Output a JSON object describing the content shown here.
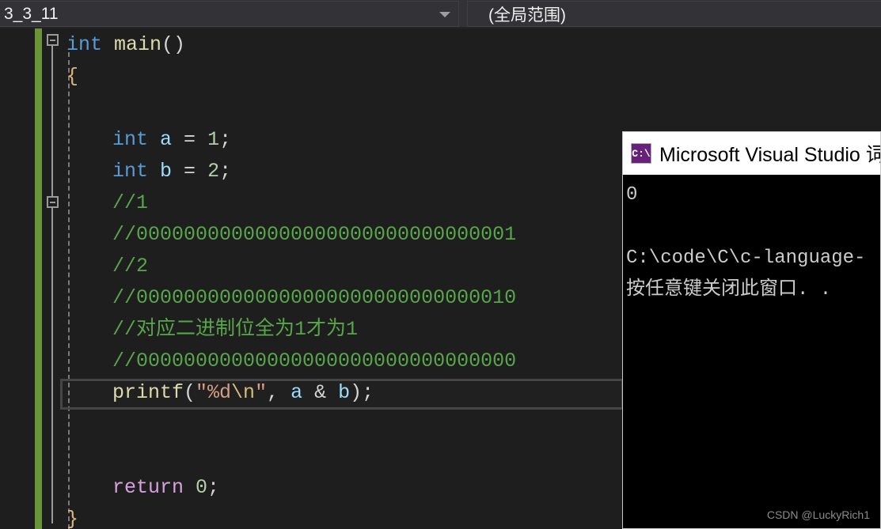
{
  "topbar": {
    "scope_combo": {
      "value": "3_3_11",
      "arrow_icon": "chevron-down-icon"
    },
    "member_combo": {
      "value": "(全局范围)"
    }
  },
  "editor": {
    "change_bar_color": "#6a9437",
    "theme_bg": "#1e1e1e",
    "fold_markers": [
      {
        "name": "fold-marker-main",
        "state": "expanded"
      },
      {
        "name": "fold-marker-block",
        "state": "expanded"
      }
    ],
    "lines": [
      {
        "id": "line-1",
        "indent": 0,
        "segments": [
          {
            "t": "int",
            "c": "kw"
          },
          {
            "t": " ",
            "c": "punc"
          },
          {
            "t": "main",
            "c": "fn"
          },
          {
            "t": "()",
            "c": "punc"
          }
        ]
      },
      {
        "id": "line-2",
        "indent": 0,
        "segments": [
          {
            "t": "{",
            "c": "brace"
          }
        ]
      },
      {
        "id": "line-3",
        "indent": 0,
        "segments": [
          {
            "t": "",
            "c": "punc"
          }
        ]
      },
      {
        "id": "line-4",
        "indent": 1,
        "segments": [
          {
            "t": "int",
            "c": "kw"
          },
          {
            "t": " ",
            "c": "punc"
          },
          {
            "t": "a",
            "c": "var"
          },
          {
            "t": " = ",
            "c": "punc"
          },
          {
            "t": "1",
            "c": "num"
          },
          {
            "t": ";",
            "c": "punc"
          }
        ]
      },
      {
        "id": "line-5",
        "indent": 1,
        "segments": [
          {
            "t": "int",
            "c": "kw"
          },
          {
            "t": " ",
            "c": "punc"
          },
          {
            "t": "b",
            "c": "var"
          },
          {
            "t": " = ",
            "c": "punc"
          },
          {
            "t": "2",
            "c": "num"
          },
          {
            "t": ";",
            "c": "punc"
          }
        ]
      },
      {
        "id": "line-6",
        "indent": 1,
        "segments": [
          {
            "t": "//1",
            "c": "comment"
          }
        ]
      },
      {
        "id": "line-7",
        "indent": 1,
        "segments": [
          {
            "t": "//00000000000000000000000000000001",
            "c": "comment"
          }
        ]
      },
      {
        "id": "line-8",
        "indent": 1,
        "segments": [
          {
            "t": "//2",
            "c": "comment"
          }
        ]
      },
      {
        "id": "line-9",
        "indent": 1,
        "segments": [
          {
            "t": "//00000000000000000000000000000010",
            "c": "comment"
          }
        ]
      },
      {
        "id": "line-10",
        "indent": 1,
        "segments": [
          {
            "t": "//对应二进制位全为1才为1",
            "c": "comment"
          }
        ]
      },
      {
        "id": "line-11",
        "indent": 1,
        "segments": [
          {
            "t": "//00000000000000000000000000000000",
            "c": "comment"
          }
        ]
      },
      {
        "id": "line-12",
        "indent": 1,
        "segments": [
          {
            "t": "printf",
            "c": "fn"
          },
          {
            "t": "(",
            "c": "punc"
          },
          {
            "t": "\"%d",
            "c": "str"
          },
          {
            "t": "\\n",
            "c": "esc"
          },
          {
            "t": "\"",
            "c": "str"
          },
          {
            "t": ", ",
            "c": "punc"
          },
          {
            "t": "a",
            "c": "var"
          },
          {
            "t": " & ",
            "c": "punc"
          },
          {
            "t": "b",
            "c": "var"
          },
          {
            "t": ");",
            "c": "punc"
          }
        ]
      },
      {
        "id": "line-13",
        "indent": 0,
        "segments": [
          {
            "t": "",
            "c": "punc"
          }
        ]
      },
      {
        "id": "line-14",
        "indent": 0,
        "segments": [
          {
            "t": "",
            "c": "punc"
          }
        ]
      },
      {
        "id": "line-15",
        "indent": 1,
        "segments": [
          {
            "t": "return",
            "c": "ctl"
          },
          {
            "t": " ",
            "c": "punc"
          },
          {
            "t": "0",
            "c": "num"
          },
          {
            "t": ";",
            "c": "punc"
          }
        ]
      },
      {
        "id": "line-16",
        "indent": 0,
        "segments": [
          {
            "t": "}",
            "c": "brace"
          }
        ]
      }
    ],
    "current_line_id": "line-12"
  },
  "console": {
    "icon": "cmd-prompt-icon",
    "icon_glyph": "C:\\",
    "title": "Microsoft Visual Studio 词",
    "output": [
      "0",
      "",
      "C:\\code\\C\\c-language-",
      "按任意键关闭此窗口. ."
    ]
  },
  "watermark": "CSDN @LuckyRich1"
}
